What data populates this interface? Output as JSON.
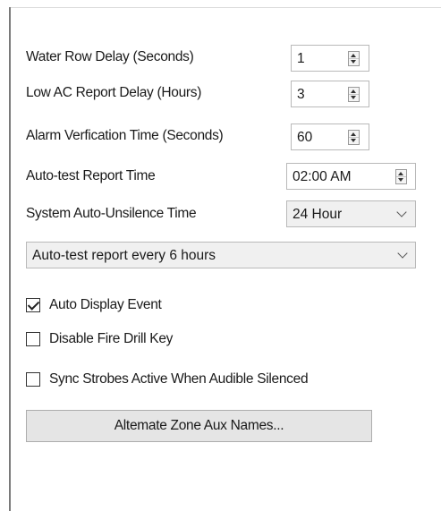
{
  "settings": {
    "water_flow_delay": {
      "label": "Water Row Delay (Seconds)",
      "value": "1"
    },
    "low_ac_report_delay": {
      "label": "Low AC Report Delay (Hours)",
      "value": "3"
    },
    "alarm_verification_time": {
      "label": "Alarm Verfication Time (Seconds)",
      "value": "60"
    },
    "autotest_report_time": {
      "label": "Auto-test Report Time",
      "value": "02:00 AM"
    },
    "system_auto_unsilence": {
      "label": "System Auto-Unsilence Time",
      "value": "24 Hour"
    },
    "autotest_frequency": {
      "value": "Auto-test report every 6 hours"
    }
  },
  "options": [
    {
      "label": "Auto Display Event",
      "checked": true
    },
    {
      "label": "Disable Fire Drill Key",
      "checked": false
    },
    {
      "label": "Sync Strobes Active When Audible Silenced",
      "checked": false
    }
  ],
  "alternate_zone_button": {
    "label": "Altemate Zone Aux Names..."
  }
}
